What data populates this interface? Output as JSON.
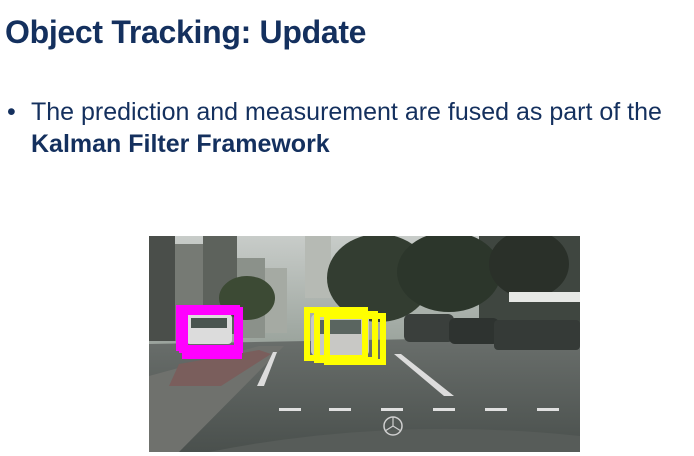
{
  "slide": {
    "title": "Object Tracking: Update",
    "bullet": {
      "text_before": "The prediction and measurement are fused as part of the ",
      "text_bold": "Kalman Filter Framework"
    }
  },
  "figure": {
    "boxes": [
      {
        "name": "tracked-car-left",
        "color": "#ff00ff"
      },
      {
        "name": "tracked-car-center",
        "color": "#ffff00"
      }
    ]
  }
}
